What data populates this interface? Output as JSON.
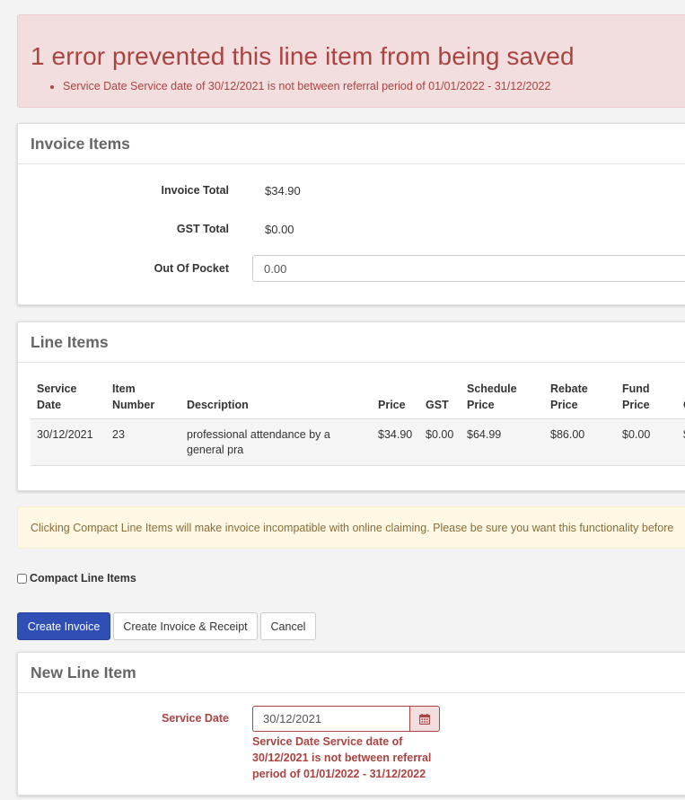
{
  "error_alert": {
    "title": "1 error prevented this line item from being saved",
    "items": [
      "Service Date Service date of 30/12/2021 is not between referral period of 01/01/2022 - 31/12/2022"
    ]
  },
  "invoice_items": {
    "heading": "Invoice Items",
    "invoice_total_label": "Invoice Total",
    "invoice_total_value": "$34.90",
    "gst_total_label": "GST Total",
    "gst_total_value": "$0.00",
    "out_of_pocket_label": "Out Of Pocket",
    "out_of_pocket_value": "0.00"
  },
  "line_items": {
    "heading": "Line Items",
    "columns": [
      "Service Date",
      "Item Number",
      "Description",
      "Price",
      "GST",
      "Schedule Price",
      "Rebate Price",
      "Fund Price",
      "G"
    ],
    "rows": [
      {
        "service_date": "30/12/2021",
        "item_number": "23",
        "description": "professional attendance by a general pra",
        "price": "$34.90",
        "gst": "$0.00",
        "schedule_price": "$64.99",
        "rebate_price": "$86.00",
        "fund_price": "$0.00",
        "gap": "$"
      }
    ]
  },
  "warning": {
    "text": "Clicking Compact Line Items will make invoice incompatible with online claiming. Please be sure you want this functionality before"
  },
  "compact": {
    "label": "Compact Line Items",
    "checked": false
  },
  "buttons": {
    "create_invoice": "Create Invoice",
    "create_invoice_receipt": "Create Invoice & Receipt",
    "cancel": "Cancel"
  },
  "new_line_item": {
    "heading": "New Line Item",
    "service_date_label": "Service Date",
    "service_date_value": "30/12/2021",
    "service_date_error": "Service Date Service date of 30/12/2021 is not between referral period of 01/01/2022 - 31/12/2022"
  },
  "icons": {
    "date_addon": "calendar-icon"
  },
  "colors": {
    "primary": "#2f4fb5",
    "error": "#a94442",
    "warning_text": "#8a6d3b"
  }
}
